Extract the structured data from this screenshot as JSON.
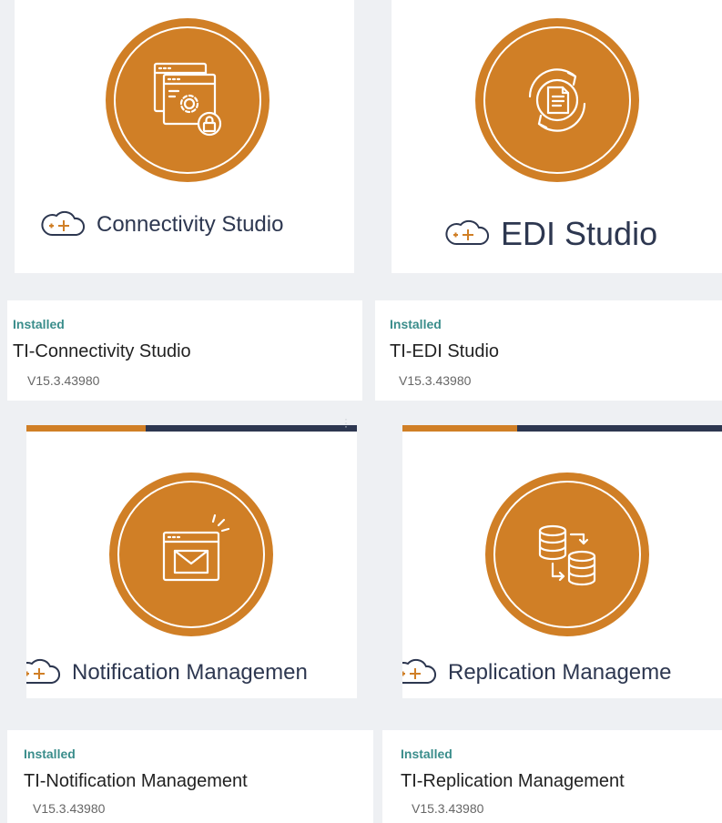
{
  "cards": [
    {
      "brand": "Connectivity Studio",
      "status": "Installed",
      "title": "TI-Connectivity Studio",
      "version": "V15.3.43980"
    },
    {
      "brand": "EDI Studio",
      "status": "Installed",
      "title": "TI-EDI Studio",
      "version": "V15.3.43980"
    },
    {
      "brand": "Notification Managemen",
      "status": "Installed",
      "title": "TI-Notification Management",
      "version": "V15.3.43980"
    },
    {
      "brand": "Replication Manageme",
      "status": "Installed",
      "title": "TI-Replication Management",
      "version": "V15.3.43980"
    }
  ],
  "icons": [
    "window-gear-lock-icon",
    "document-cycle-icon",
    "envelope-window-icon",
    "database-sync-icon"
  ],
  "colors": {
    "accent": "#d07f26",
    "navy": "#2d3750",
    "installed": "#3a8d8b",
    "background": "#eef0f3"
  }
}
